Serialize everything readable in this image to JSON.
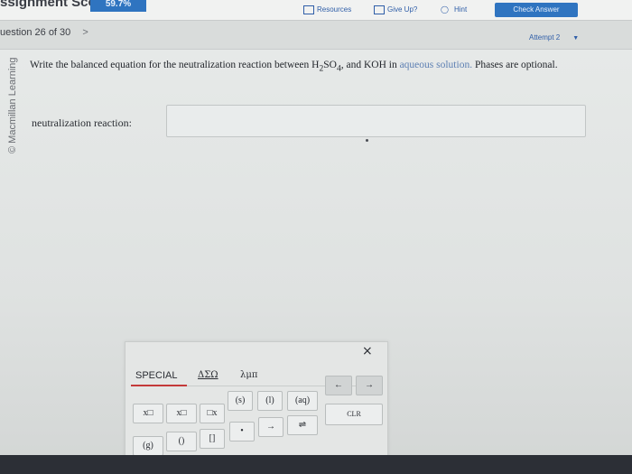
{
  "header": {
    "assignment_label": "ssignment Score:",
    "score": "59.7%",
    "resources_label": "Resources",
    "give_up_label": "Give Up?",
    "hint_label": "Hint",
    "check_label": "Check Answer"
  },
  "question_nav": {
    "label": "uestion 26 of 30",
    "next_glyph": ">",
    "attempt": "Attempt 2"
  },
  "sidebar": {
    "copyright": "© Macmillan Learning"
  },
  "question": {
    "prompt_start": "Write the balanced equation for the neutralization reaction between H",
    "sub2": "2",
    "so": "SO",
    "sub4": "4",
    "prompt_mid": ", and KOH in ",
    "prompt_faint": "aqueous solution.",
    "prompt_end": " Phases are optional.",
    "answer_label": "neutralization reaction:",
    "answer_value": ""
  },
  "palette": {
    "close_glyph": "×",
    "tabs": [
      "SPECIAL",
      "ΔΣΩ",
      "λμπ"
    ],
    "keys_row1": [
      "x□",
      "x□",
      "□x",
      "(s)",
      "(l)",
      "(aq)"
    ],
    "keys_row2": [
      "(g)",
      "()",
      "[]",
      "•",
      "→",
      "⇌"
    ],
    "arrow_left": "←",
    "arrow_right": "→",
    "clr": "CLR"
  }
}
